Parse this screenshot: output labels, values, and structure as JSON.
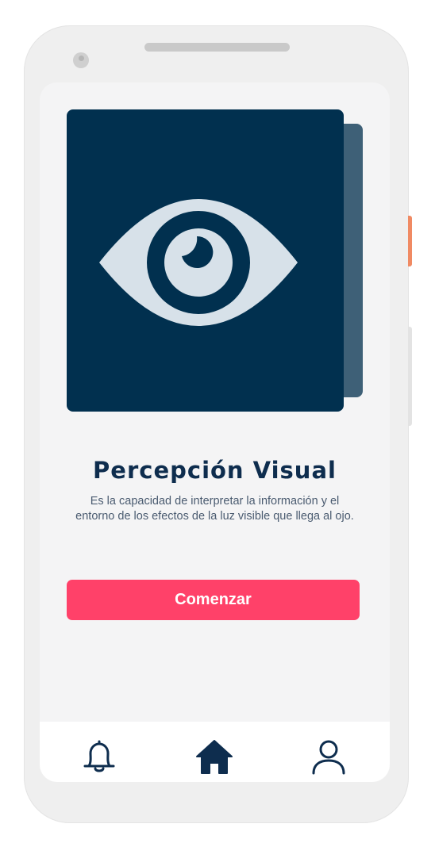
{
  "lesson": {
    "title": "Percepción Visual",
    "description": "Es la capacidad de interpretar la información y el entorno de los efectos de la luz visible que llega al ojo.",
    "icon": "eye-icon"
  },
  "actions": {
    "start_label": "Comenzar"
  },
  "bottom_nav": {
    "items": [
      {
        "icon": "bell-icon",
        "label": ""
      },
      {
        "icon": "home-icon",
        "label": ""
      },
      {
        "icon": "user-icon",
        "label": ""
      }
    ]
  },
  "colors": {
    "card": "#01304f",
    "card_back": "#3e6077",
    "eye": "#d7e1e9",
    "accent": "#ff4169",
    "text_primary": "#0e2d4e",
    "text_secondary": "#4a5b70",
    "device_frame": "#efefef",
    "side_button": "#f08a63"
  }
}
